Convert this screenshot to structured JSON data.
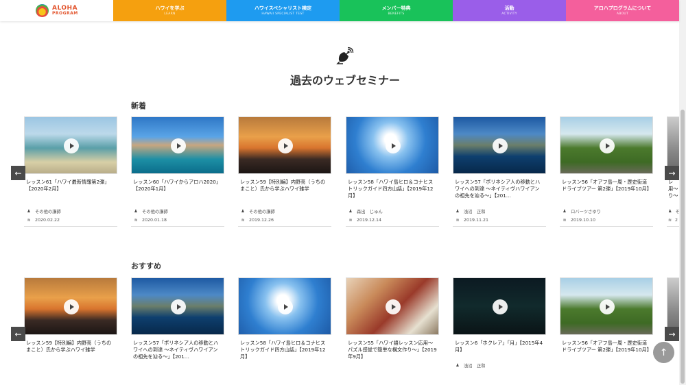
{
  "header": {
    "logo_line1": "ALOHA",
    "logo_line2": "PROGRAM",
    "nav": [
      {
        "jp": "ハワイを学ぶ",
        "en": "LEARN"
      },
      {
        "jp": "ハワイスペシャリスト検定",
        "en": "HAWAII SPECIALIST TEST"
      },
      {
        "jp": "メンバー特典",
        "en": "BENEFITS"
      },
      {
        "jp": "活動",
        "en": "ACTIVITY"
      },
      {
        "jp": "アロハプログラムについて",
        "en": "ABOUT"
      }
    ]
  },
  "colors": {
    "learn": "#f5a00f",
    "test": "#1e9bf0",
    "benefits": "#19c25a",
    "activity": "#9a5ee9",
    "about": "#f45f9c"
  },
  "section": {
    "icon": "satellite-dish-icon",
    "title": "過去のウェブセミナー"
  },
  "new_row": {
    "label": "新着",
    "cards": [
      {
        "title": "レッスン61「ハワイ最新情報第2弾」【2020年2月】",
        "instructor": "その他の講師",
        "date": "2020.02.22",
        "image": "beach"
      },
      {
        "title": "レッスン60「ハワイからアロハ2020」【2020年1月】",
        "instructor": "その他の講師",
        "date": "2020.01.18",
        "image": "city"
      },
      {
        "title": "レッスン59【特別編】内野亮（うちのまこと）氏から学ぶハワイ雑学",
        "instructor": "その他の講師",
        "date": "2019.12.26",
        "image": "sunset"
      },
      {
        "title": "レッスン58「ハワイ島ヒロ＆コナヒストリックガイド四方山話」【2019年12月】",
        "instructor": "森出　じゅん",
        "date": "2019.12.14",
        "image": "sky"
      },
      {
        "title": "レッスン57「ポリネシア人の移動とハワイへの到達 〜ネイティヴハワイアンの祖先を辿る〜」【201…",
        "instructor": "浅沼　正和",
        "date": "2019.11.21",
        "image": "ocean"
      },
      {
        "title": "レッスン56「オアフ島一周・歴史街道ドライブツアー 第2弾」【2019年10月】",
        "instructor": "ロバーツさゆり",
        "date": "2019.10.10",
        "image": "road"
      }
    ],
    "partial_card": {
      "title": "レ用〜り〜",
      "instructor": "そ",
      "date": "2"
    }
  },
  "recommended_row": {
    "label": "おすすめ",
    "cards": [
      {
        "title": "レッスン59【特別編】内野亮（うちのまこと）氏から学ぶハワイ雑学",
        "instructor": "",
        "date": "",
        "image": "sunset"
      },
      {
        "title": "レッスン57「ポリネシア人の移動とハワイへの到達 〜ネイティヴハワイアンの祖先を辿る〜」【201…",
        "instructor": "",
        "date": "",
        "image": "ocean"
      },
      {
        "title": "レッスン58「ハワイ島ヒロ＆コナヒストリックガイド四方山話」【2019年12月】",
        "instructor": "",
        "date": "",
        "image": "sky"
      },
      {
        "title": "レッスン55「ハワイ語レッスン応用〜パズル感覚で簡単な構文作り〜」【2019年9月】",
        "instructor": "",
        "date": "",
        "image": "people"
      },
      {
        "title": "レッスン6「ホクレア」「月」【2015年4月】",
        "instructor": "浅沼　正和",
        "date": "",
        "image": "night"
      },
      {
        "title": "レッスン56「オアフ島一周・歴史街道ドライブツアー 第2弾」【2019年10月】",
        "instructor": "",
        "date": "",
        "image": "road"
      }
    ]
  },
  "arrows": {
    "prev": "←",
    "next": "→"
  },
  "to_top": "↑"
}
